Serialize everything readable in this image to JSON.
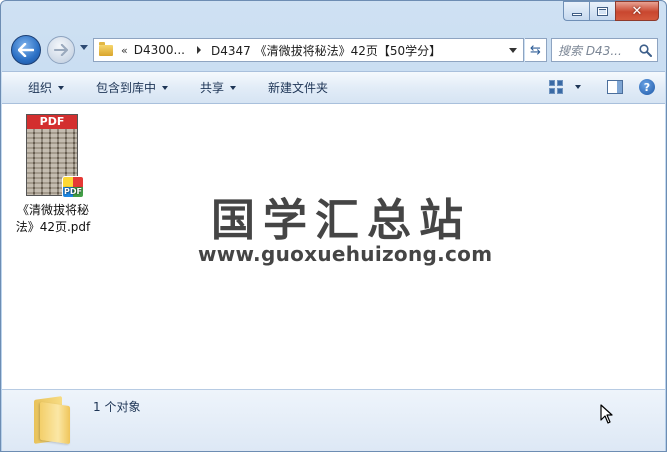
{
  "window": {
    "caption": {
      "minimize_icon": "minimize-icon",
      "maximize_icon": "maximize-icon",
      "close_icon": "close-icon",
      "close_glyph": "✕"
    }
  },
  "nav": {
    "back_icon": "back-arrow-icon",
    "forward_icon": "forward-arrow-icon",
    "address": {
      "overflow": "«",
      "crumbs": [
        "D4300...",
        "D4347 《清微拔将秘法》42页【50学分】"
      ]
    },
    "refresh_glyph": "⇆",
    "search": {
      "placeholder": "搜索 D43..."
    }
  },
  "toolbar": {
    "organize": "组织",
    "include_in_library": "包含到库中",
    "share": "共享",
    "new_folder": "新建文件夹",
    "help_glyph": "?"
  },
  "content": {
    "files": [
      {
        "name": "《清微拔将秘法》42页.pdf",
        "thumb_banner": "PDF",
        "badge": "PDF"
      }
    ],
    "watermark": {
      "title": "国学汇总站",
      "url": "www.guoxuehuizong.com"
    }
  },
  "details": {
    "status": "1 个对象"
  },
  "colors": {
    "accent": "#2a6fc4",
    "pdf_red": "#d32f2f",
    "watermark": "#454545"
  }
}
